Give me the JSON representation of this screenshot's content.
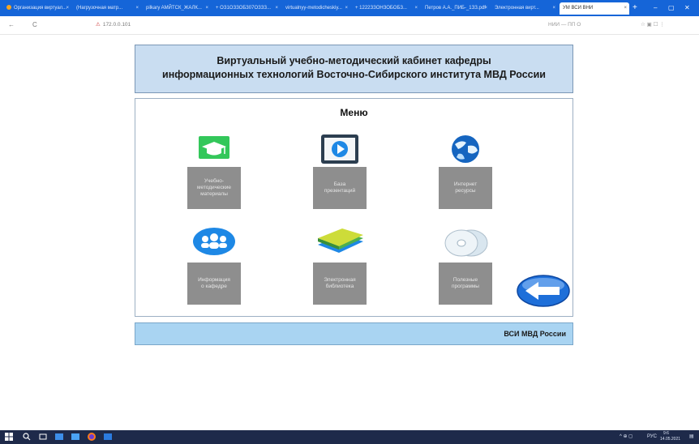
{
  "browser": {
    "tabs": [
      {
        "label": "Организация виртуал..."
      },
      {
        "label": "(Нагрузочная матр..."
      },
      {
        "label": "pilkary AMЙТСК_ЖАЛК..."
      },
      {
        "label": "+ ОЗ1ОЗЗОБЗ07ОЗЗЗ..."
      },
      {
        "label": "virtualnyy-metodicheskiy..."
      },
      {
        "label": "+ 1222ЗЗОНЗОБОБЗ..."
      },
      {
        "label": "Петров А.А._ПИБ-_1ЗЗ.pdf"
      },
      {
        "label": "Электронная вирт..."
      },
      {
        "label": "УМ ВСИ ВНИ"
      }
    ],
    "active_tab_index": 8,
    "new_tab_symbol": "+",
    "window_controls": [
      "–",
      "▢",
      "✕"
    ],
    "nav": {
      "back": "←",
      "forward": "→",
      "reload": "C"
    },
    "url": "172.0.0.101",
    "addr_right": "НИИ — ПП О"
  },
  "page": {
    "header_line1": "Виртуальный учебно-методический кабинет кафедры",
    "header_line2": "информационных технологий Восточно-Сибирского института МВД России",
    "menu_title": "Меню",
    "items": [
      {
        "label": "Учебно-\nметодические\nматериалы",
        "icon": "graduation-cap-icon"
      },
      {
        "label": "База\nпрезентаций",
        "icon": "video-play-icon"
      },
      {
        "label": "Интернет\nресурсы",
        "icon": "globe-icon"
      },
      {
        "label": "Информация\nо кафедре",
        "icon": "people-icon"
      },
      {
        "label": "Электронная\nбиблиотека",
        "icon": "books-icon"
      },
      {
        "label": "Полезные\nпрограммы",
        "icon": "discs-icon"
      }
    ],
    "back_icon": "back-arrow-icon",
    "footer_text": "ВСИ МВД России"
  },
  "taskbar": {
    "tray_lang": "РУС",
    "tray_time": "9:6",
    "tray_date": "14.05.2021"
  },
  "colors": {
    "header_bg": "#c9ddf1",
    "footer_bg": "#a9d4f2",
    "button_bg": "#8e8e8e",
    "tabbar_bg": "#1565d8",
    "taskbar_bg": "#1e2a4a"
  }
}
